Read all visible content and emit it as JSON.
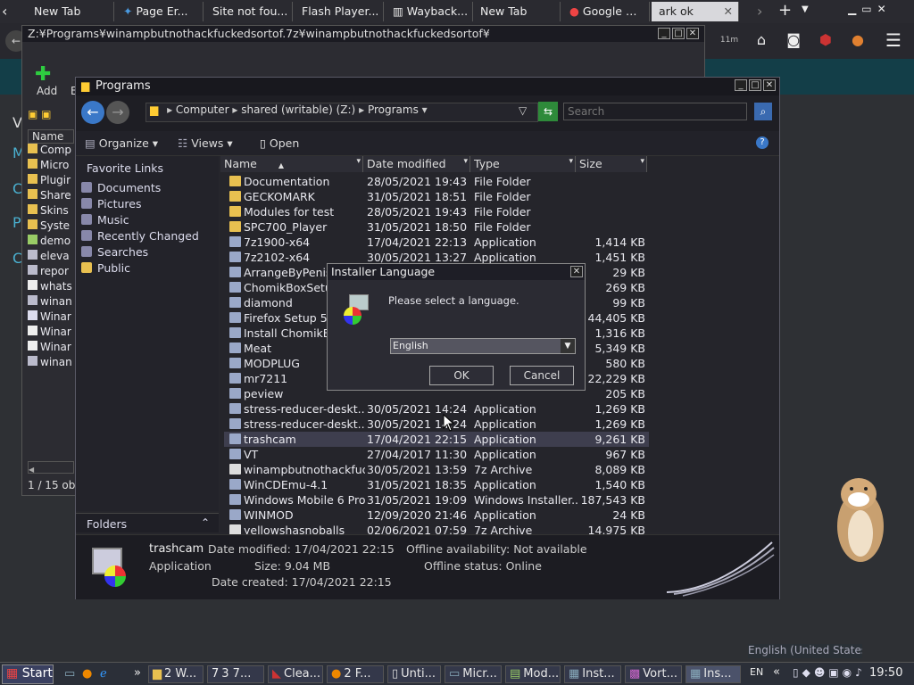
{
  "browser": {
    "tabs": [
      "New Tab",
      "Page Er...",
      "Site not fou...",
      "Flash Player...",
      "Wayback...",
      "New Tab",
      "Google",
      "ark ok"
    ],
    "page_links": [
      "M",
      "C",
      "P",
      "C"
    ],
    "page_heading": "V"
  },
  "win7z": {
    "title": "Z:¥Programs¥winampbutnothackfuckedsortof.7z¥winampbutnothackfuckedsortof¥",
    "add_label": "Add",
    "cut_label": "E",
    "list_header": "Name",
    "items": [
      "Comp",
      "Micro",
      "Plugir",
      "Share",
      "Skins",
      "Syste",
      "demo",
      "eleva",
      "repor",
      "whats",
      "winan",
      "Winar",
      "Winar",
      "Winar",
      "winan"
    ],
    "status": "1 / 15 ob"
  },
  "explorer": {
    "title": "Programs",
    "breadcrumb": [
      "Computer",
      "shared (writable) (Z:)",
      "Programs"
    ],
    "search_placeholder": "Search",
    "commands": {
      "organize": "Organize",
      "views": "Views",
      "open": "Open"
    },
    "nav_heading": "Favorite Links",
    "nav_items": [
      "Documents",
      "Pictures",
      "Music",
      "Recently Changed",
      "Searches",
      "Public"
    ],
    "folders_label": "Folders",
    "columns": [
      "Name",
      "Date modified",
      "Type",
      "Size"
    ],
    "files": [
      {
        "name": "Documentation",
        "date": "28/05/2021 19:43",
        "type": "File Folder",
        "size": ""
      },
      {
        "name": "GECKOMARK",
        "date": "31/05/2021 18:51",
        "type": "File Folder",
        "size": ""
      },
      {
        "name": "Modules for test",
        "date": "28/05/2021 19:43",
        "type": "File Folder",
        "size": ""
      },
      {
        "name": "SPC700_Player",
        "date": "31/05/2021 18:50",
        "type": "File Folder",
        "size": ""
      },
      {
        "name": "7z1900-x64",
        "date": "17/04/2021 22:13",
        "type": "Application",
        "size": "1,414 KB"
      },
      {
        "name": "7z2102-x64",
        "date": "30/05/2021 13:27",
        "type": "Application",
        "size": "1,451 KB"
      },
      {
        "name": "ArrangeByPenis",
        "date": "",
        "type": "",
        "size": "29 KB"
      },
      {
        "name": "ChomikBoxSetup",
        "date": "",
        "type": "",
        "size": "269 KB"
      },
      {
        "name": "diamond",
        "date": "",
        "type": "",
        "size": "99 KB"
      },
      {
        "name": "Firefox Setup 52",
        "date": "",
        "type": "",
        "size": "44,405 KB"
      },
      {
        "name": "Install ChomikBo",
        "date": "",
        "type": "",
        "size": "1,316 KB"
      },
      {
        "name": "Meat",
        "date": "",
        "type": "",
        "size": "5,349 KB"
      },
      {
        "name": "MODPLUG",
        "date": "",
        "type": "",
        "size": "580 KB"
      },
      {
        "name": "mr7211",
        "date": "",
        "type": "",
        "size": "22,229 KB"
      },
      {
        "name": "peview",
        "date": "",
        "type": "",
        "size": "205 KB"
      },
      {
        "name": "stress-reducer-deskt...",
        "date": "30/05/2021 14:24",
        "type": "Application",
        "size": "1,269 KB"
      },
      {
        "name": "stress-reducer-deskt...",
        "date": "30/05/2021 14:24",
        "type": "Application",
        "size": "1,269 KB"
      },
      {
        "name": "trashcam",
        "date": "17/04/2021 22:15",
        "type": "Application",
        "size": "9,261 KB"
      },
      {
        "name": "VT",
        "date": "27/04/2017 11:30",
        "type": "Application",
        "size": "967 KB"
      },
      {
        "name": "winampbutnothackfuc...",
        "date": "30/05/2021 13:59",
        "type": "7z Archive",
        "size": "8,089 KB"
      },
      {
        "name": "WinCDEmu-4.1",
        "date": "31/05/2021 18:35",
        "type": "Application",
        "size": "1,540 KB"
      },
      {
        "name": "Windows Mobile 6 Pro...",
        "date": "31/05/2021 19:09",
        "type": "Windows Installer...",
        "size": "187,543 KB"
      },
      {
        "name": "WINMOD",
        "date": "12/09/2020 21:46",
        "type": "Application",
        "size": "24 KB"
      },
      {
        "name": "yellowshasnoballs",
        "date": "02/06/2021 07:59",
        "type": "7z Archive",
        "size": "14,975 KB"
      }
    ],
    "details": {
      "name": "trashcam",
      "kind": "Application",
      "modified_label": "Date modified:",
      "modified": "17/04/2021 22:15",
      "size_label": "Size:",
      "size": "9.04 MB",
      "created_label": "Date created:",
      "created": "17/04/2021 22:15",
      "offline_avail_label": "Offline availability:",
      "offline_avail": "Not available",
      "offline_status_label": "Offline status:",
      "offline_status": "Online"
    }
  },
  "dialog": {
    "title": "Installer Language",
    "message": "Please select a language.",
    "selected": "English",
    "ok": "OK",
    "cancel": "Cancel"
  },
  "language_tooltip": "English (United States",
  "taskbar": {
    "start": "Start",
    "items": [
      "2 W...",
      "3 7...",
      "Clea...",
      "2 F...",
      "Unti...",
      "Micr...",
      "Mod...",
      "Inst...",
      "Vort...",
      "Ins..."
    ],
    "lang": "EN",
    "clock": "19:50"
  }
}
